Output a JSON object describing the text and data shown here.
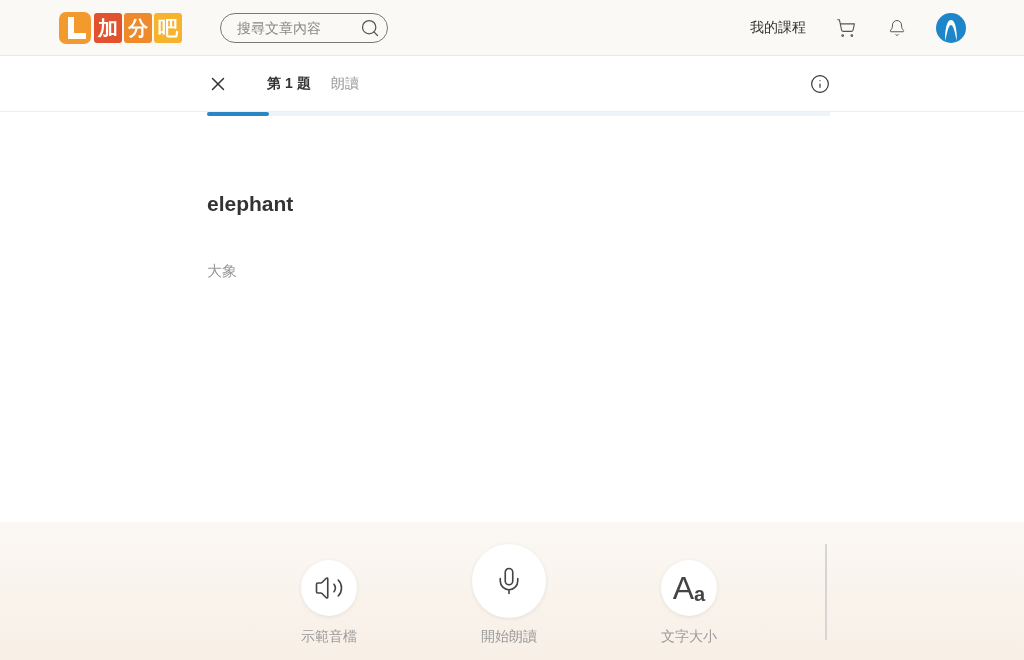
{
  "logo": {
    "tiles": [
      "加",
      "分",
      "吧"
    ]
  },
  "search": {
    "placeholder": "搜尋文章內容"
  },
  "nav": {
    "my_courses": "我的課程"
  },
  "quiz_bar": {
    "question": "第 1 題",
    "mode": "朗讀",
    "progress": {
      "level": 0.1
    }
  },
  "word": {
    "text": "elephant",
    "translation": "大象"
  },
  "actions": [
    {
      "kind": "speaker",
      "label": "示範音檔"
    },
    {
      "kind": "mic",
      "label": "開始朗讀"
    },
    {
      "kind": "font",
      "label": "文字大小",
      "glyph_big": "A",
      "glyph_small": "a"
    }
  ]
}
